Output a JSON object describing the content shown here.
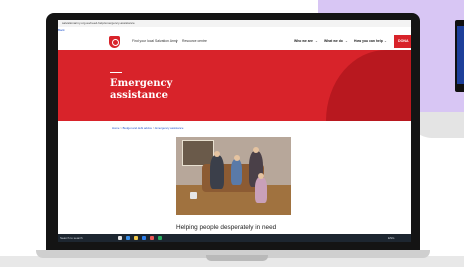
{
  "browser": {
    "url": "salvationarmy.org.au/need-help/emergency-assistance",
    "back_link": "Back"
  },
  "site_nav": {
    "find_local": "Find your local Salvation Army",
    "divider": "|",
    "resource_centre": "Resource centre",
    "who_we_are": "Who we are",
    "what_we_do": "What we do",
    "how_you_can_help": "How you can help",
    "chevron": "⌄",
    "donate": "DONA"
  },
  "hero": {
    "title_line1": "Emergency",
    "title_line2": "assistance"
  },
  "breadcrumb": {
    "home": "Home",
    "sep": " > ",
    "need_help": "Budget and debt advice",
    "current": "Emergency assistance"
  },
  "content": {
    "subheading": "Helping people desperately in need"
  },
  "taskbar": {
    "search": "Search to search",
    "tray": "ENG"
  },
  "colors": {
    "brand_red": "#d8232a",
    "hero_dark_red": "#b8181f",
    "backdrop_purple": "#d8c6f4"
  }
}
